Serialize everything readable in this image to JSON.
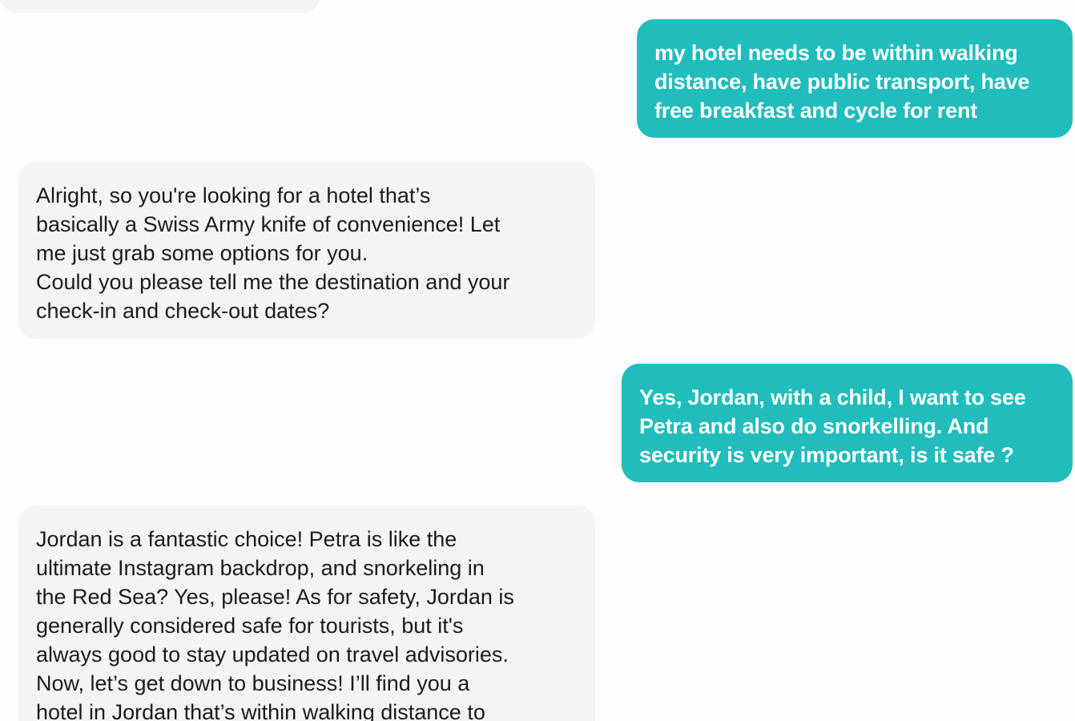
{
  "conversation": {
    "messages": [
      {
        "role": "user",
        "text": "my hotel needs to be within walking\ndistance, have public transport, have\nfree breakfast and cycle for rent"
      },
      {
        "role": "assistant",
        "text": "Alright, so you're looking for a hotel that’s\nbasically a Swiss Army knife of convenience! Let\nme just grab some options for you.\nCould you please tell me the destination and your\ncheck-in and check-out dates?"
      },
      {
        "role": "user",
        "text": "Yes, Jordan, with a child, I want to see\nPetra and also do snorkelling. And\nsecurity is very important, is it safe ?"
      },
      {
        "role": "assistant",
        "text": "Jordan is a fantastic choice! Petra is like the\nultimate Instagram backdrop, and snorkeling in\nthe Red Sea? Yes, please! As for safety, Jordan is\ngenerally considered safe for tourists, but it's\nalways good to stay updated on travel advisories.\nNow, let’s get down to business! I’ll find you a\nhotel in Jordan that’s within walking distance to"
      }
    ]
  },
  "colors": {
    "user_bubble": "#21bcbc",
    "assistant_bubble": "#f4f4f4",
    "background": "#fdfdfd"
  }
}
